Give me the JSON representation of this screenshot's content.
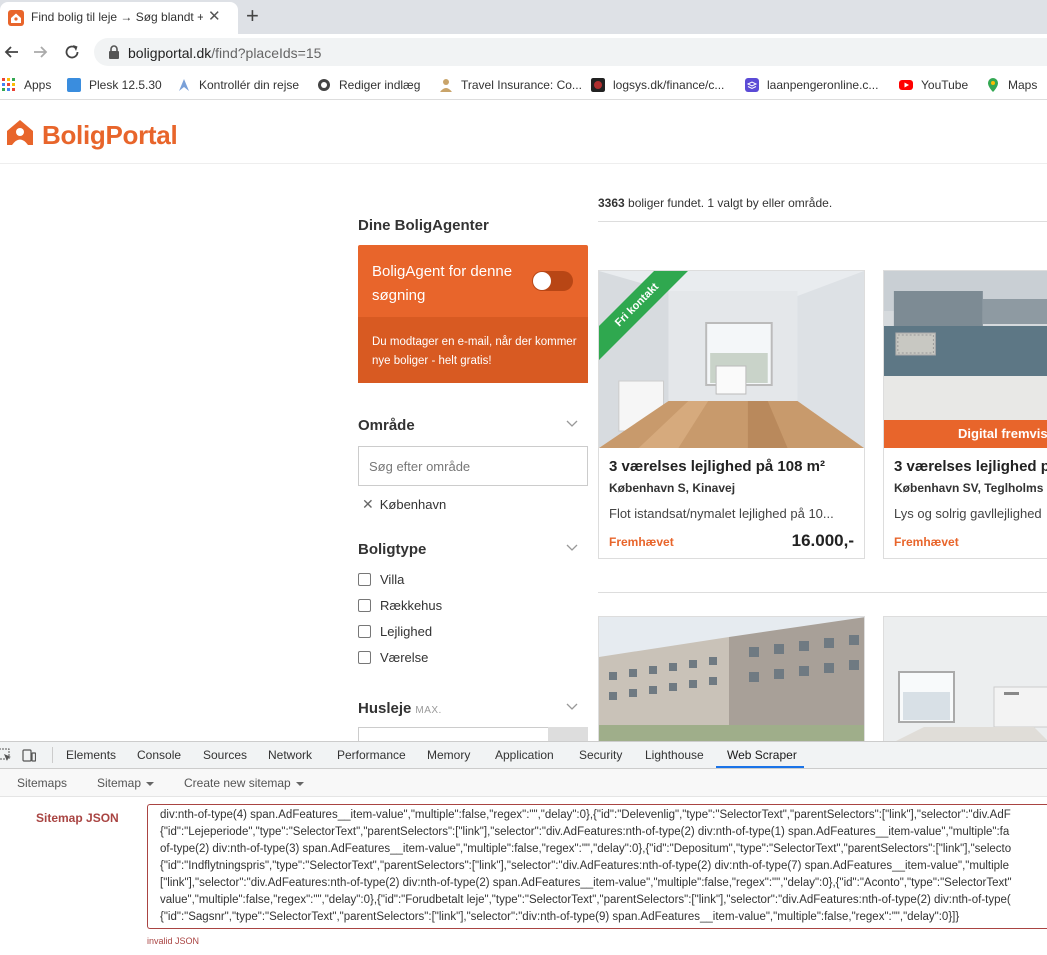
{
  "browser": {
    "tab_title": "Find bolig til leje → Søg blandt +",
    "url_host": "boligportal.dk",
    "url_path": "/find?placeIds=15",
    "bookmarks": [
      {
        "label": "Apps",
        "color": "#4285f4"
      },
      {
        "label": "Plesk 12.5.30",
        "color": "#3a8dde"
      },
      {
        "label": "Kontrollér din rejse",
        "color": "#7aa0d8"
      },
      {
        "label": "Rediger indlæg",
        "color": "#444444"
      },
      {
        "label": "Travel Insurance: Co...",
        "color": "#c9a46a"
      },
      {
        "label": "logsys.dk/finance/c...",
        "color": "#b03030"
      },
      {
        "label": "laanpengeronline.c...",
        "color": "#5b4bd6"
      },
      {
        "label": "YouTube",
        "color": "#ff0000"
      },
      {
        "label": "Maps",
        "color": "#34a853"
      }
    ]
  },
  "site": {
    "logo": "BoligPortal",
    "brand_color": "#e8652b",
    "results_count": "3363",
    "results_suffix": " boliger fundet. 1 valgt by eller område."
  },
  "sidebar": {
    "agents_heading": "Dine BoligAgenter",
    "agent_title": "BoligAgent for denne søgning",
    "agent_desc": "Du modtager en e-mail, når der kommer nye boliger - helt gratis!",
    "area_heading": "Område",
    "area_placeholder": "Søg efter område",
    "area_selected": "København",
    "type_heading": "Boligtype",
    "types": [
      "Villa",
      "Rækkehus",
      "Lejlighed",
      "Værelse"
    ],
    "rent_heading": "Husleje",
    "rent_suffix": "MAX."
  },
  "listings": [
    {
      "ribbon": "Fri kontakt",
      "title": "3 værelses lejlighed på 108 m²",
      "location": "København S, Kinavej",
      "desc": "Flot istandsat/nymalet lejlighed på 10...",
      "tag": "Fremhævet",
      "price": "16.000,-"
    },
    {
      "banner": "Digital fremvis",
      "title": "3 værelses lejlighed p",
      "location": "København SV, Teglholms",
      "desc": "Lys og solrig gavllejlighed",
      "tag": "Fremhævet"
    }
  ],
  "devtools": {
    "tabs": [
      "Elements",
      "Console",
      "Sources",
      "Network",
      "Performance",
      "Memory",
      "Application",
      "Security",
      "Lighthouse",
      "Web Scraper"
    ],
    "active_tab": "Web Scraper",
    "scraper_nav": [
      "Sitemaps",
      "Sitemap",
      "Create new sitemap"
    ],
    "sitemap_label": "Sitemap JSON",
    "json_lines": [
      "div:nth-of-type(4) span.AdFeatures__item-value\",\"multiple\":false,\"regex\":\"\",\"delay\":0},{\"id\":\"Delevenlig\",\"type\":\"SelectorText\",\"parentSelectors\":[\"link\"],\"selector\":\"div.AdF",
      "{\"id\":\"Lejeperiode\",\"type\":\"SelectorText\",\"parentSelectors\":[\"link\"],\"selector\":\"div.AdFeatures:nth-of-type(2) div:nth-of-type(1) span.AdFeatures__item-value\",\"multiple\":fa",
      "of-type(2) div:nth-of-type(3) span.AdFeatures__item-value\",\"multiple\":false,\"regex\":\"\",\"delay\":0},{\"id\":\"Depositum\",\"type\":\"SelectorText\",\"parentSelectors\":[\"link\"],\"selecto",
      "{\"id\":\"Indflytningspris\",\"type\":\"SelectorText\",\"parentSelectors\":[\"link\"],\"selector\":\"div.AdFeatures:nth-of-type(2) div:nth-of-type(7) span.AdFeatures__item-value\",\"multiple",
      "[\"link\"],\"selector\":\"div.AdFeatures:nth-of-type(2) div:nth-of-type(2) span.AdFeatures__item-value\",\"multiple\":false,\"regex\":\"\",\"delay\":0},{\"id\":\"Aconto\",\"type\":\"SelectorText\"",
      "value\",\"multiple\":false,\"regex\":\"\",\"delay\":0},{\"id\":\"Forudbetalt leje\",\"type\":\"SelectorText\",\"parentSelectors\":[\"link\"],\"selector\":\"div.AdFeatures:nth-of-type(2) div:nth-of-type(",
      "{\"id\":\"Sagsnr\",\"type\":\"SelectorText\",\"parentSelectors\":[\"link\"],\"selector\":\"div:nth-of-type(9) span.AdFeatures__item-value\",\"multiple\":false,\"regex\":\"\",\"delay\":0}]}"
    ],
    "error": "invalid JSON",
    "error_color": "#a94442"
  }
}
